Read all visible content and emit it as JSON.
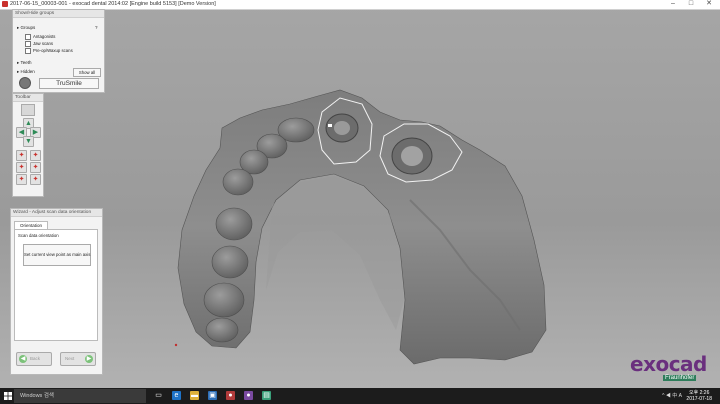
{
  "window": {
    "title": "2017-06-15_00003-001 - exocad dental 2014:02 [Engine build 5153] [Demo Version]",
    "minimize": "–",
    "maximize": "□",
    "close": "✕"
  },
  "show_hide": {
    "header": "Show/Hide groups",
    "groups_label": "Groups",
    "help": "?",
    "items": [
      "Antagonists",
      "Jaw scans",
      "Pre-op/Waxup scans"
    ],
    "teeth_label": "Teeth",
    "hidden_label": "Hidden",
    "show_all": "Show all",
    "trusmile": "TruSmile"
  },
  "toolbar": {
    "header": "Toolbar"
  },
  "wizard": {
    "header": "Wizard - Adjust scan data orientation",
    "tab": "Orientation",
    "section": "Scan data orientation",
    "button": "Set current view point as main axis",
    "back": "Back",
    "next": "Next"
  },
  "logo": {
    "brand": "exocad",
    "sub": "Fraunhofer"
  },
  "taskbar": {
    "search": "Windows 검색",
    "time": "오후 2:26",
    "date": "2017-07-18",
    "tray": "^ ◀ 中 A"
  },
  "colors": {
    "brand": "#6a2f7e",
    "model": "#8e8e8e",
    "accent": "#c9302c"
  }
}
